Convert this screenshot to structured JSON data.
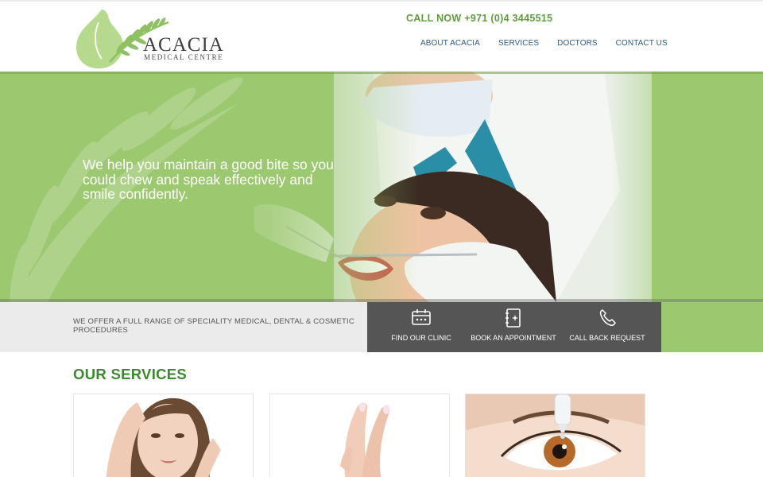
{
  "brand": {
    "name": "ACACIA",
    "subtitle": "MEDICAL CENTRE",
    "leaf_color": "#b5d98d"
  },
  "header": {
    "call_now": "CALL NOW +971 (0)4 3445515",
    "nav": [
      {
        "label": "ABOUT ACACIA"
      },
      {
        "label": "SERVICES"
      },
      {
        "label": "DOCTORS"
      },
      {
        "label": "CONTACT US"
      }
    ]
  },
  "hero": {
    "headline": "We help you maintain a good bite so you could chew and speak effectively and smile confidently.",
    "background_color": "#9cc96f"
  },
  "strip": {
    "text": "WE OFFER A FULL RANGE OF SPECIALITY MEDICAL, DENTAL & COSMETIC PROCEDURES",
    "actions": [
      {
        "label": "FIND OUR CLINIC",
        "icon": "calendar-icon"
      },
      {
        "label": "BOOK AN APPOINTMENT",
        "icon": "notebook-icon"
      },
      {
        "label": "CALL BACK REQUEST",
        "icon": "phone-icon"
      }
    ],
    "dark_color": "#555555"
  },
  "services": {
    "title": "OUR SERVICES",
    "cards": [
      {
        "image": "woman-face-skincare"
      },
      {
        "image": "hands-manicure"
      },
      {
        "image": "eye-drops"
      }
    ]
  },
  "colors": {
    "accent_green": "#5e9e3c",
    "title_green": "#3b8a2e",
    "nav_blue": "#2d5b7f"
  }
}
